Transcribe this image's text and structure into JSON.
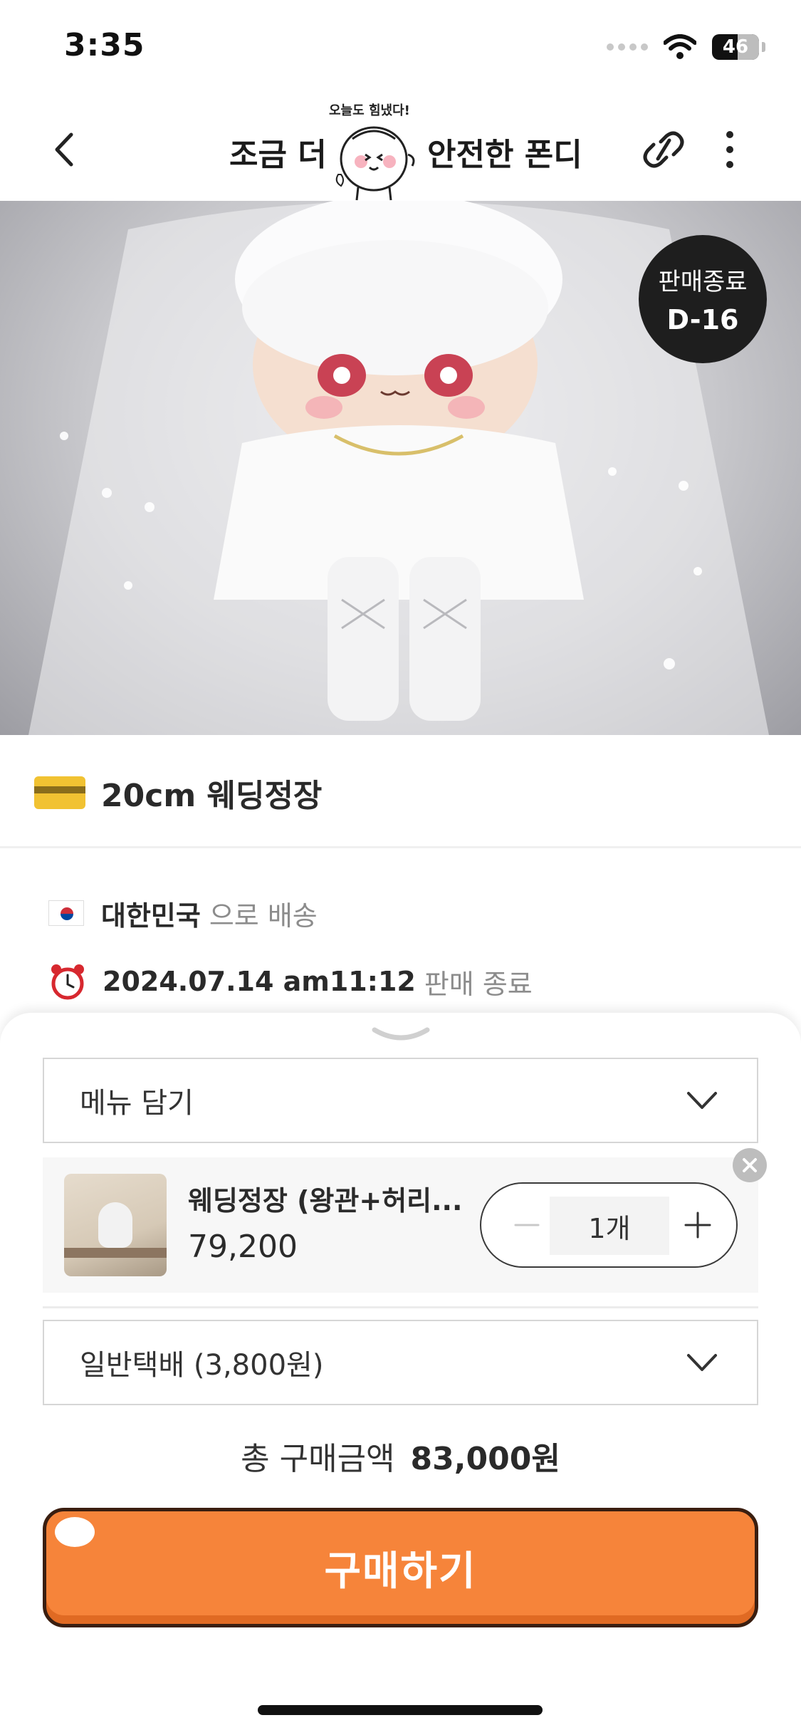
{
  "status_bar": {
    "time": "3:35",
    "battery": "46"
  },
  "header": {
    "title_left": "조금 더",
    "title_right": "안전한 폰디",
    "mascot_caption": "오늘도 힘냈다!",
    "icons": [
      "chevron-left-icon",
      "link-icon",
      "more-vertical-icon"
    ]
  },
  "hero": {
    "badge_line1": "판매종료",
    "badge_line2": "D-16"
  },
  "product": {
    "title": "20cm 웨딩정장",
    "shipping_country": "대한민국",
    "shipping_suffix": "으로 배송",
    "sale_end_datetime": "2024.07.14 am11:12",
    "sale_end_suffix": "판매 종료"
  },
  "sheet": {
    "menu_select": "메뉴 담기",
    "cart_item": {
      "name": "웨딩정장 (왕관+허리...",
      "price": "79,200",
      "quantity": "1개"
    },
    "delivery_select": "일반택배 (3,800원)",
    "total_label": "총 구매금액",
    "total_amount": "83,000원",
    "buy_button": "구매하기"
  },
  "colors": {
    "accent": "#f6843a",
    "badge_bg": "#1e1e1e"
  }
}
